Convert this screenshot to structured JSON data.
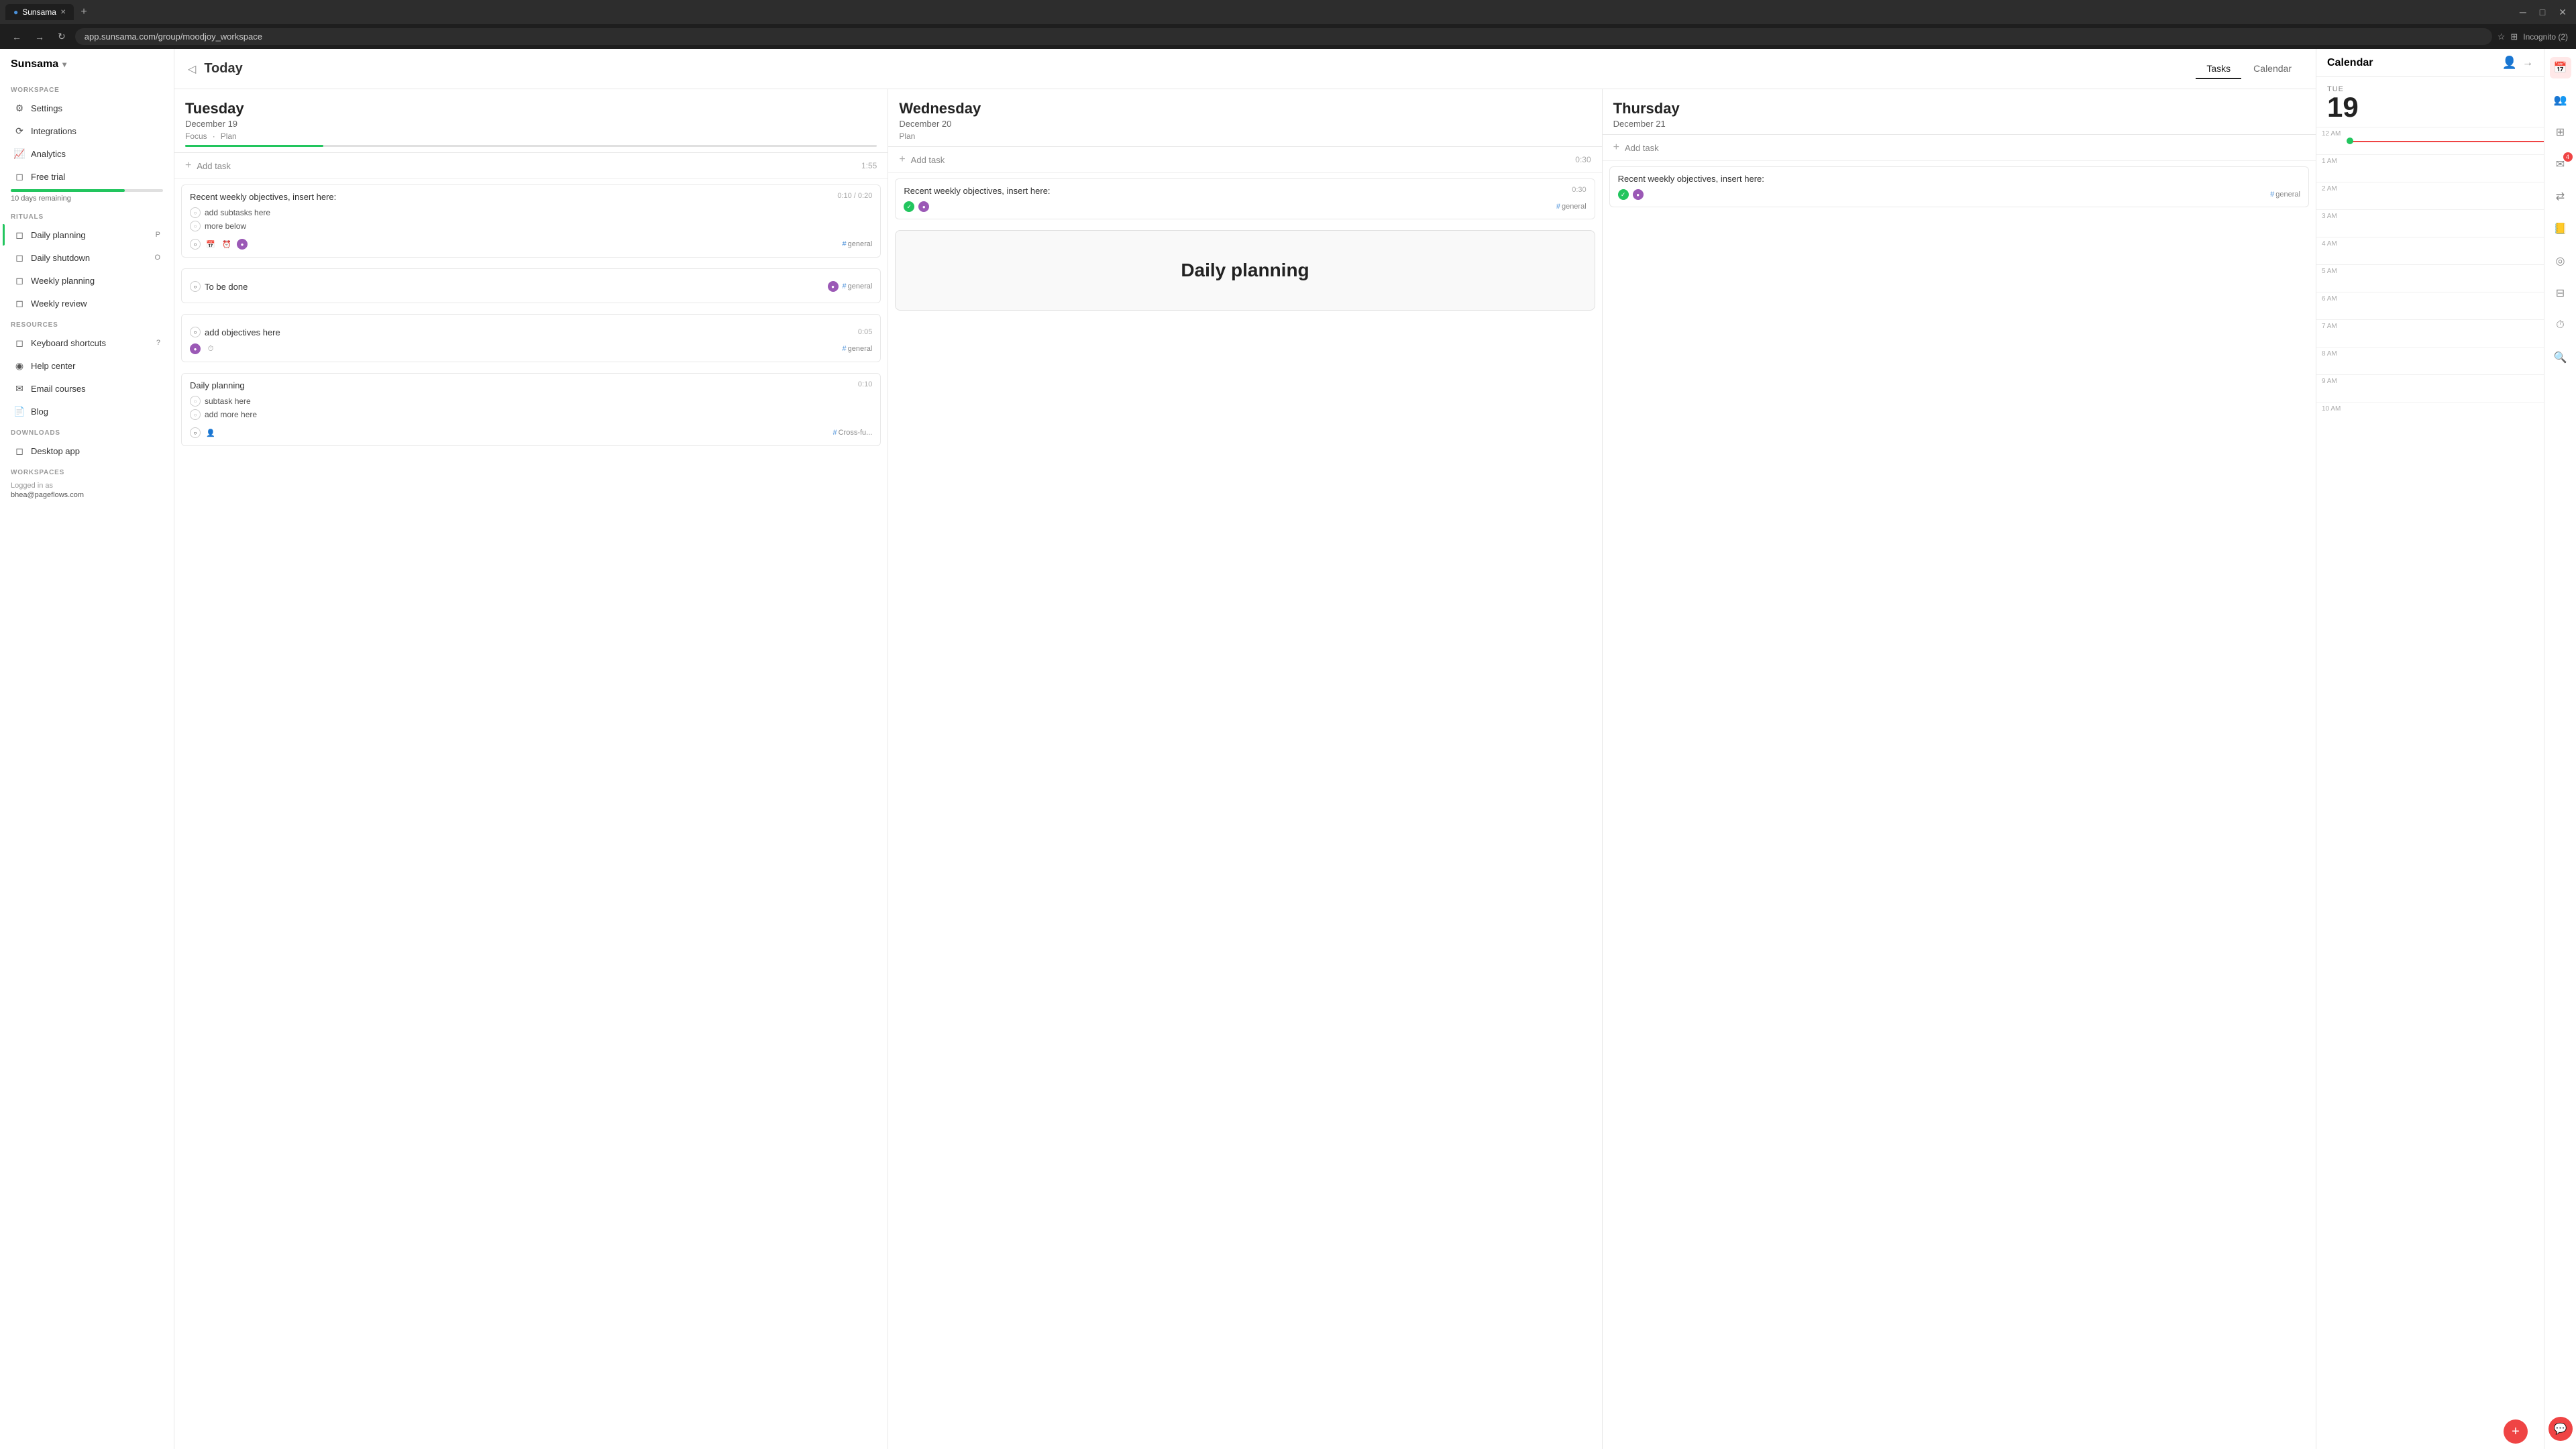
{
  "browser": {
    "tab_label": "Sunsama",
    "url": "app.sunsama.com/group/moodjoy_workspace"
  },
  "sidebar": {
    "app_name": "Sunsama",
    "workspace_label": "WORKSPACE",
    "settings_label": "Settings",
    "integrations_label": "Integrations",
    "analytics_label": "Analytics",
    "free_trial_label": "Free trial",
    "free_trial_note": "10 days remaining",
    "rituals_label": "RITUALS",
    "daily_planning_label": "Daily planning",
    "daily_planning_badge": "P",
    "daily_shutdown_label": "Daily shutdown",
    "daily_shutdown_badge": "O",
    "weekly_planning_label": "Weekly planning",
    "weekly_review_label": "Weekly review",
    "resources_label": "RESOURCES",
    "keyboard_shortcuts_label": "Keyboard shortcuts",
    "help_center_label": "Help center",
    "email_courses_label": "Email courses",
    "blog_label": "Blog",
    "downloads_label": "DOWNLOADS",
    "desktop_app_label": "Desktop app",
    "workspaces_label": "WORKSPACES",
    "logged_in_label": "Logged in as",
    "user_email": "bhea@pageflows.com"
  },
  "topbar": {
    "today_label": "Today",
    "tasks_tab": "Tasks",
    "calendar_tab": "Calendar"
  },
  "days": [
    {
      "name": "Tuesday",
      "date": "December 19",
      "actions": [
        "Focus",
        "Plan"
      ],
      "add_task_label": "Add task",
      "add_task_time": "1:55",
      "tasks": [
        {
          "title": "Recent weekly objectives, insert here:",
          "time": "0:10 / 0:20",
          "subtasks": [
            "add subtasks here",
            "more below"
          ],
          "tag": "general"
        },
        {
          "title": "To be done",
          "time": "",
          "tag": "general"
        },
        {
          "title": "add objectives here",
          "time": "0:05",
          "tag": "general"
        },
        {
          "title": "Daily planning",
          "time": "0:10",
          "subtasks": [
            "subtask here",
            "add more here"
          ],
          "tag": "Cross-fu..."
        }
      ]
    },
    {
      "name": "Wednesday",
      "date": "December 20",
      "actions": [
        "Plan"
      ],
      "add_task_label": "Add task",
      "add_task_time": "0:30",
      "tasks": [
        {
          "title": "Recent weekly objectives, insert here:",
          "time": "0:30",
          "tag": "general"
        }
      ]
    },
    {
      "name": "Thursday",
      "date": "December 21",
      "actions": [],
      "add_task_label": "Add task",
      "add_task_time": "",
      "tasks": [
        {
          "title": "Recent weekly objectives, insert here:",
          "time": "",
          "tag": "general"
        }
      ]
    }
  ],
  "calendar": {
    "title": "Calendar",
    "day_name": "TUE",
    "day_number": "19",
    "time_slots": [
      "12 AM",
      "1 AM",
      "2 AM",
      "3 AM",
      "4 AM",
      "5 AM",
      "6 AM",
      "7 AM",
      "8 AM",
      "9 AM",
      "10 AM"
    ]
  },
  "daily_planning_big": {
    "title": "Daily planning"
  },
  "colors": {
    "green": "#22c55e",
    "purple": "#9b59b6",
    "red": "#ef4444",
    "blue": "#4a90d9"
  }
}
